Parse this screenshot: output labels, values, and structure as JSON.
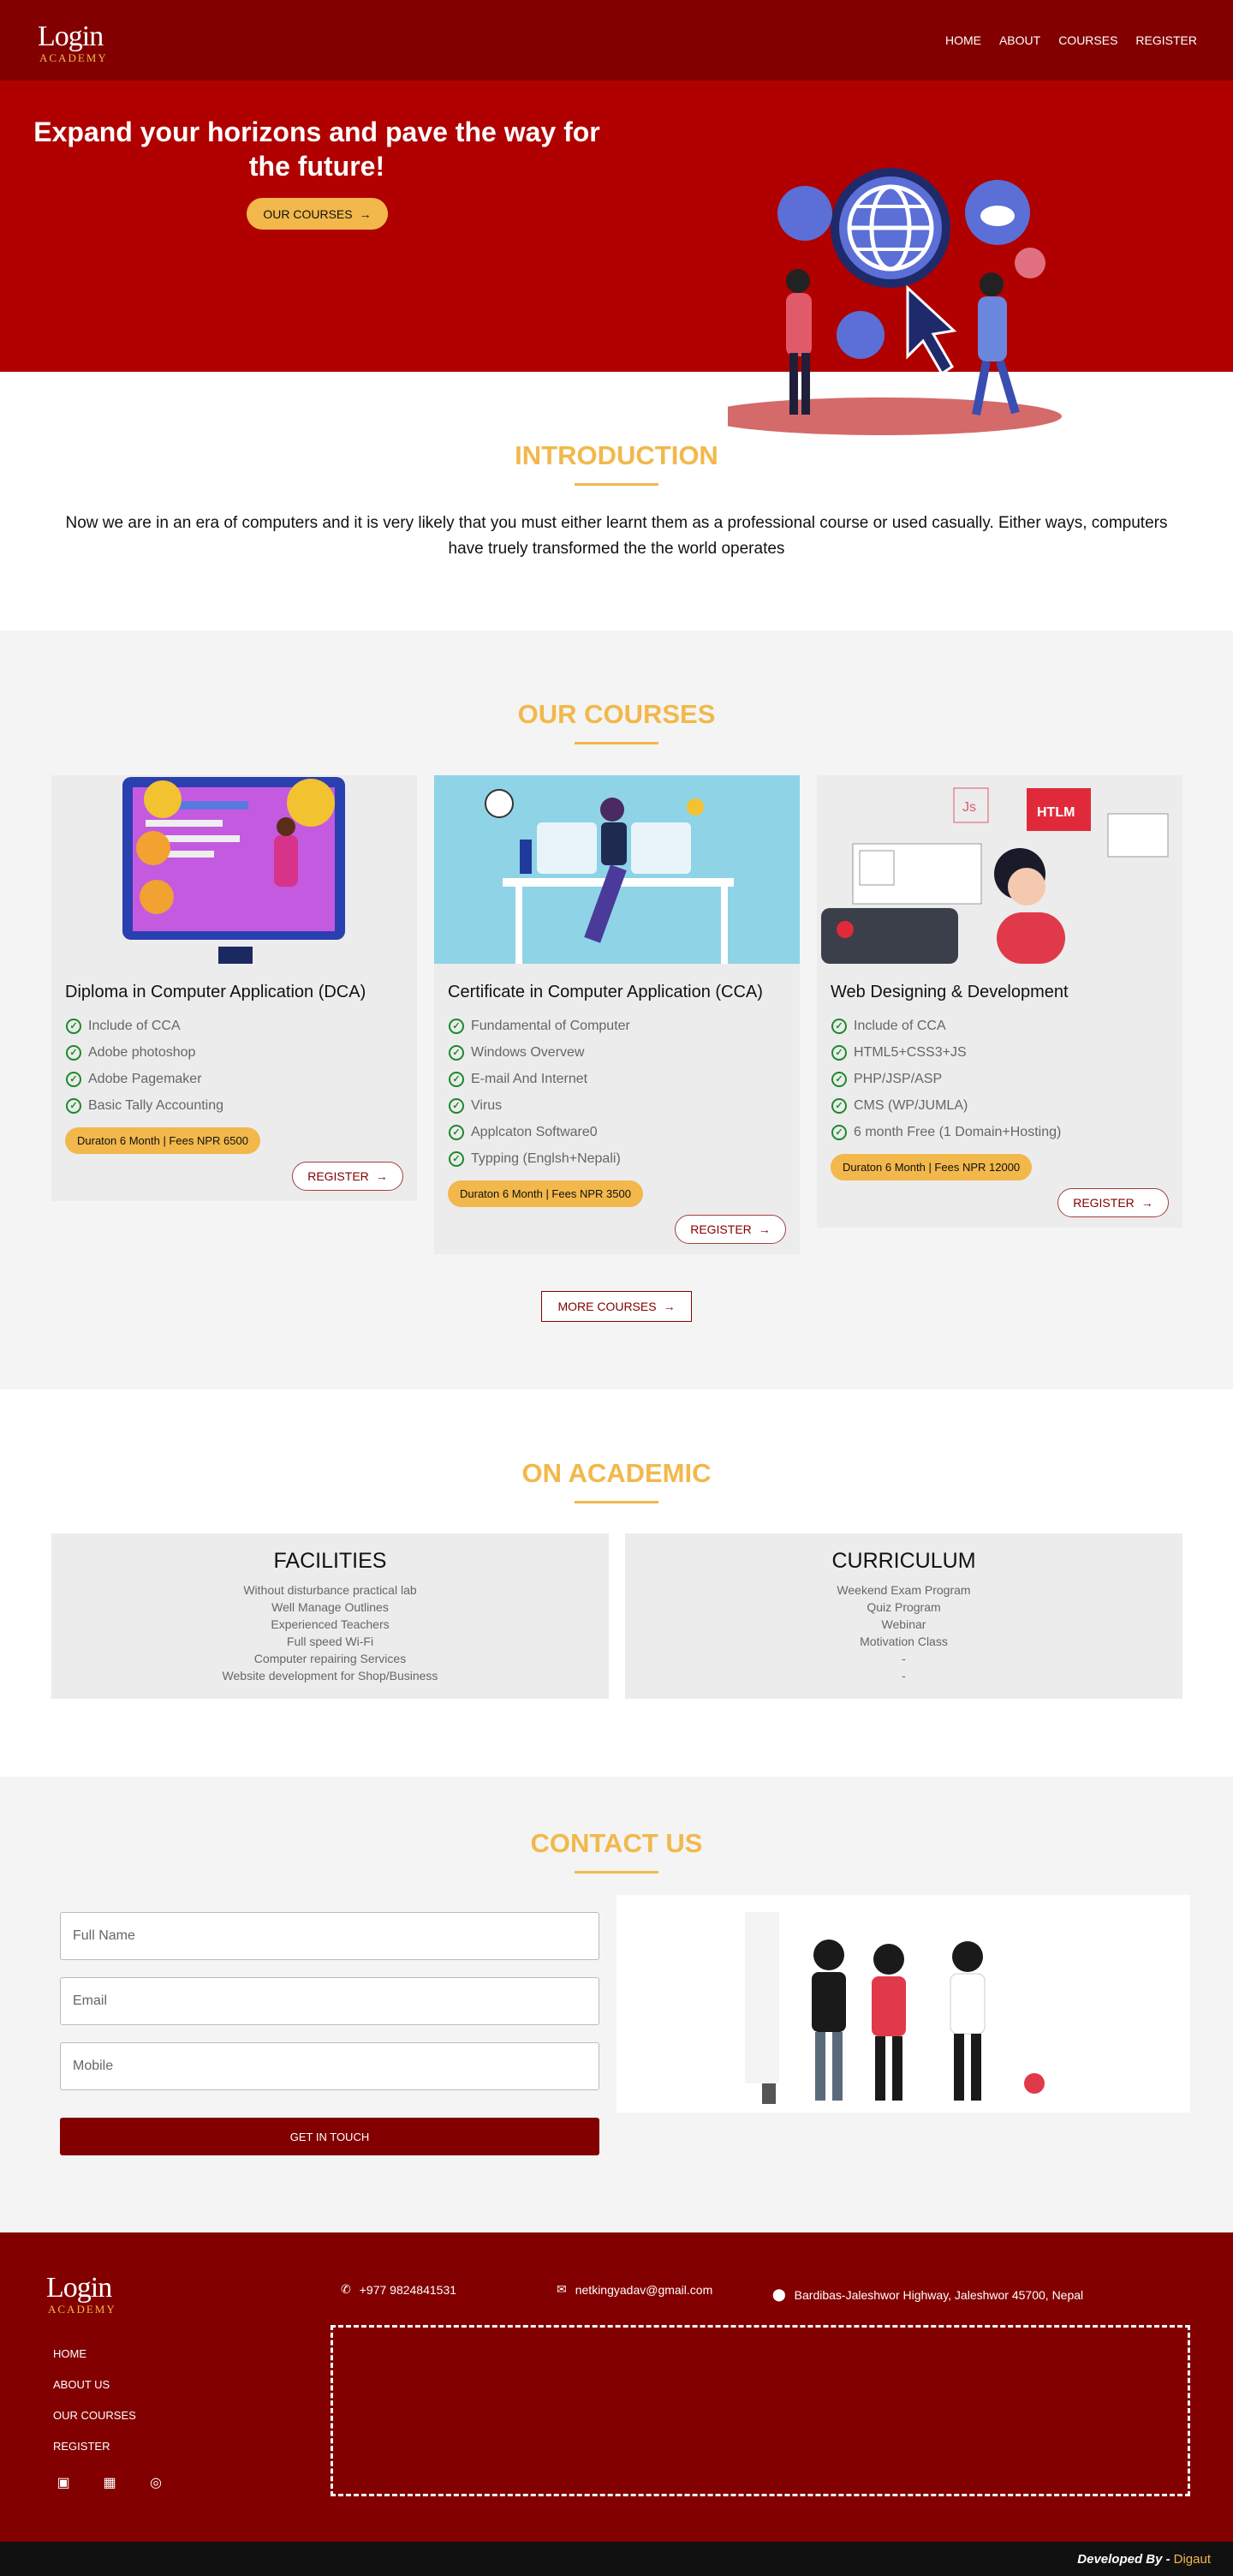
{
  "nav": {
    "logo_main": "Login",
    "logo_sub": "ACADEMY",
    "items": [
      "HOME",
      "ABOUT",
      "COURSES",
      "REGISTER"
    ]
  },
  "hero": {
    "title": "Expand your horizons and pave the way for the future!",
    "button": "OUR COURSES"
  },
  "intro": {
    "title": "INTRODUCTION",
    "text": "Now we are in an era of computers and it is very likely that you must either learnt them as a professional course or used casually. Either ways, computers have truely transformed the the world operates"
  },
  "courses": {
    "title": "OUR COURSES",
    "items": [
      {
        "title": "Diploma in Computer Application (DCA)",
        "features": [
          "Include of CCA",
          "Adobe photoshop",
          "Adobe Pagemaker",
          "Basic Tally Accounting"
        ],
        "fee": "Duraton 6 Month | Fees NPR 6500",
        "button": "REGISTER"
      },
      {
        "title": "Certificate in Computer Application (CCA)",
        "features": [
          "Fundamental of Computer",
          "Windows Overvew",
          "E-mail And Internet",
          "Virus",
          "Applcaton Software0",
          "Typping (Englsh+Nepali)"
        ],
        "fee": "Duraton 6 Month | Fees NPR 3500",
        "button": "REGISTER"
      },
      {
        "title": "Web Designing & Development",
        "features": [
          "Include of CCA",
          "HTML5+CSS3+JS",
          "PHP/JSP/ASP",
          "CMS (WP/JUMLA)",
          "6 month Free (1 Domain+Hosting)"
        ],
        "fee": "Duraton 6 Month | Fees NPR 12000",
        "button": "REGISTER"
      }
    ],
    "more_button": "MORE COURSES",
    "img_labels": {
      "js": "Js",
      "htlm": "HTLM"
    }
  },
  "academic": {
    "title": "ON ACADEMIC",
    "facilities": {
      "title": "FACILITIES",
      "items": [
        "Without disturbance practical lab",
        "Well Manage Outlines",
        "Experienced Teachers",
        "Full speed Wi-Fi",
        "Computer repairing Services",
        "Website development for Shop/Business"
      ]
    },
    "curriculum": {
      "title": "CURRICULUM",
      "items": [
        "Weekend Exam Program",
        "Quiz Program",
        "Webinar",
        "Motivation Class",
        "-",
        "-"
      ]
    }
  },
  "contact": {
    "title": "CONTACT US",
    "fullname_placeholder": "Full Name",
    "email_placeholder": "Email",
    "mobile_placeholder": "Mobile",
    "button": "GET IN TOUCH"
  },
  "footer": {
    "links": [
      "HOME",
      "ABOUT US",
      "OUR COURSES",
      "REGISTER"
    ],
    "phone": "+977 9824841531",
    "email": "netkingyadav@gmail.com",
    "address": "Bardibas-Jaleshwor Highway, Jaleshwor 45700, Nepal",
    "social": [
      "facebook-icon",
      "linkedin-icon",
      "instagram-icon"
    ],
    "developed_by": "Developed By -",
    "developer": "Digaut"
  },
  "colors": {
    "primary": "#820000",
    "hero": "#b00000",
    "accent": "#f2b84b"
  }
}
